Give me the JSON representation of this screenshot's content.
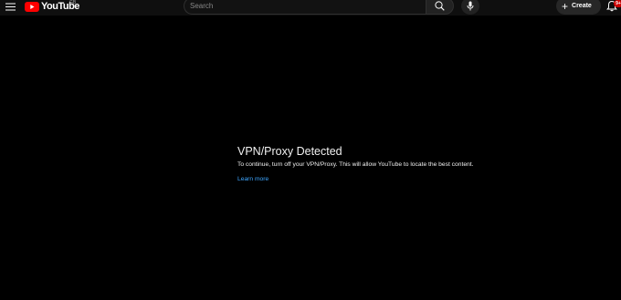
{
  "masthead": {
    "logo_text": "YouTube",
    "country_code": "GB",
    "search_placeholder": "Search",
    "create_label": "Create",
    "notification_count": "9+"
  },
  "message": {
    "title": "VPN/Proxy Detected",
    "body": "To continue, turn off your VPN/Proxy. This will allow YouTube to locate the best content.",
    "link": "Learn more"
  },
  "colors": {
    "background": "#000000",
    "masthead": "#0f0f0f",
    "brand_red": "#ff0000",
    "link_blue": "#3ea6ff",
    "badge_red": "#cc0000"
  },
  "icons": [
    "menu-icon",
    "youtube-logo-icon",
    "search-icon",
    "microphone-icon",
    "plus-icon",
    "bell-icon"
  ]
}
